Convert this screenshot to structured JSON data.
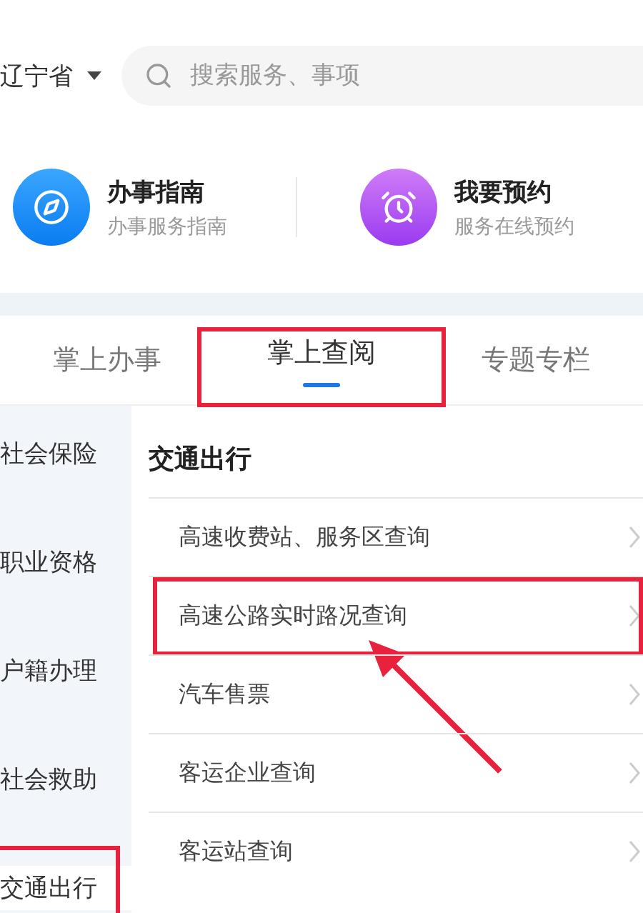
{
  "header": {
    "region": "辽宁省",
    "search": {
      "placeholder": "搜索服务、事项"
    }
  },
  "shortcuts": [
    {
      "kind": "guide",
      "title": "办事指南",
      "subtitle": "办事服务指南"
    },
    {
      "kind": "booking",
      "title": "我要预约",
      "subtitle": "服务在线预约"
    }
  ],
  "tabs": [
    {
      "label": "掌上办事",
      "selected": false,
      "highlighted": false
    },
    {
      "label": "掌上查阅",
      "selected": true,
      "highlighted": true
    },
    {
      "label": "专题专栏",
      "selected": false,
      "highlighted": false
    }
  ],
  "sidebar": {
    "items": [
      {
        "label": "社会保险",
        "selected": false,
        "highlighted": false
      },
      {
        "label": "职业资格",
        "selected": false,
        "highlighted": false
      },
      {
        "label": "户籍办理",
        "selected": false,
        "highlighted": false
      },
      {
        "label": "社会救助",
        "selected": false,
        "highlighted": false
      },
      {
        "label": "交通出行",
        "selected": true,
        "highlighted": true
      }
    ]
  },
  "content": {
    "heading": "交通出行",
    "items": [
      {
        "label": "高速收费站、服务区查询",
        "highlighted": false
      },
      {
        "label": "高速公路实时路况查询",
        "highlighted": true
      },
      {
        "label": "汽车售票",
        "highlighted": false
      },
      {
        "label": "客运企业查询",
        "highlighted": false
      },
      {
        "label": "客运站查询",
        "highlighted": false
      }
    ]
  }
}
